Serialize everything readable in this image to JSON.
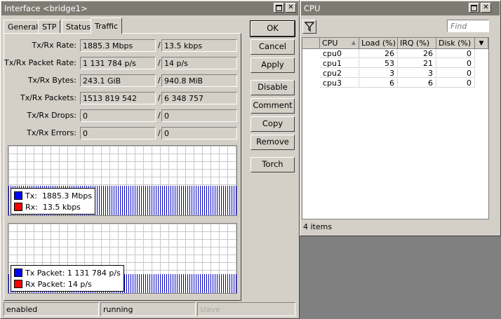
{
  "iface_window": {
    "title": "Interface <bridge1>",
    "tabs": [
      "General",
      "STP",
      "Status",
      "Traffic"
    ],
    "active_tab": "Traffic",
    "rows": [
      {
        "label": "Tx/Rx Rate:",
        "tx": "1885.3 Mbps",
        "rx": "13.5 kbps"
      },
      {
        "label": "Tx/Rx Packet Rate:",
        "tx": "1 131 784 p/s",
        "rx": "14 p/s"
      },
      {
        "label": "Tx/Rx Bytes:",
        "tx": "243.1 GiB",
        "rx": "940.8 MiB"
      },
      {
        "label": "Tx/Rx Packets:",
        "tx": "1513 819 542",
        "rx": "6 348 757"
      },
      {
        "label": "Tx/Rx Drops:",
        "tx": "0",
        "rx": "0"
      },
      {
        "label": "Tx/Rx Errors:",
        "tx": "0",
        "rx": "0"
      }
    ],
    "slash": "/",
    "graph1": {
      "tx_label": "Tx:",
      "tx_value": "1885.3 Mbps",
      "rx_label": "Rx:",
      "rx_value": "13.5 kbps"
    },
    "graph2": {
      "tx_label": "Tx Packet:",
      "tx_value": "1 131 784 p/s",
      "rx_label": "Rx Packet:",
      "rx_value": "14 p/s"
    },
    "buttons": [
      "OK",
      "Cancel",
      "Apply",
      "Disable",
      "Comment",
      "Copy",
      "Remove",
      "Torch"
    ],
    "status": [
      "enabled",
      "running",
      "slave"
    ]
  },
  "cpu_window": {
    "title": "CPU",
    "search_placeholder": "Find",
    "columns": [
      "CPU",
      "Load (%)",
      "IRQ (%)",
      "Disk (%)"
    ],
    "rows": [
      {
        "cpu": "cpu0",
        "load": "26",
        "irq": "26",
        "disk": "0"
      },
      {
        "cpu": "cpu1",
        "load": "53",
        "irq": "21",
        "disk": "0"
      },
      {
        "cpu": "cpu2",
        "load": "3",
        "irq": "3",
        "disk": "0"
      },
      {
        "cpu": "cpu3",
        "load": "6",
        "irq": "6",
        "disk": "0"
      }
    ],
    "item_count": "4 items"
  },
  "colors": {
    "tx": "#0000ff",
    "rx": "#ff0000",
    "titlebar": "#7e7b73"
  }
}
